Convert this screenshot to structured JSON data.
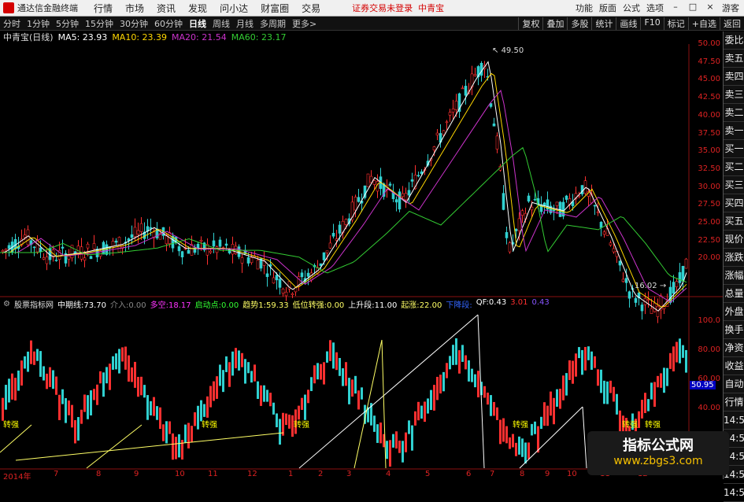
{
  "app": {
    "title": "通达信金融终端",
    "login_notice": "证券交易未登录",
    "stock_name_red": "中青宝"
  },
  "menu": [
    "行情",
    "市场",
    "资讯",
    "发现",
    "问小达",
    "财富圈",
    "交易"
  ],
  "right_menu": [
    "功能",
    "版面",
    "公式",
    "选项"
  ],
  "window_buttons": [
    "游客"
  ],
  "periods": [
    "分时",
    "1分钟",
    "5分钟",
    "15分钟",
    "30分钟",
    "60分钟",
    "日线",
    "周线",
    "月线",
    "多周期",
    "更多>"
  ],
  "active_period": "日线",
  "right_tools": [
    "复权",
    "叠加",
    "多股",
    "统计",
    "画线",
    "F10",
    "标记",
    "+自选",
    "返回"
  ],
  "stock": {
    "title": "中青宝(日线)",
    "ma5": "MA5: 23.93",
    "ma10": "MA10: 23.39",
    "ma20": "MA20: 21.54",
    "ma60": "MA60: 23.17"
  },
  "colors": {
    "ma5": "#ffffff",
    "ma10": "#ffd700",
    "ma20": "#cc33cc",
    "ma60": "#33cc33",
    "up": "#ff3030",
    "down": "#30d0d0",
    "axis": "#d22"
  },
  "price_axis": [
    "50.00",
    "47.50",
    "45.00",
    "42.50",
    "40.00",
    "37.50",
    "35.00",
    "32.50",
    "30.00",
    "27.50",
    "25.00",
    "22.50",
    "20.00"
  ],
  "annotations": {
    "high": "49.50",
    "low": "16.02"
  },
  "indicator": {
    "name": "股票指标网",
    "items": [
      {
        "label": "中期线:",
        "value": "73.70",
        "color": "#ffffff"
      },
      {
        "label": "介入:",
        "value": "0.00",
        "color": "#888888"
      },
      {
        "label": "多空:",
        "value": "18.17",
        "color": "#ff33ff"
      },
      {
        "label": "启动点:",
        "value": "0.00",
        "color": "#33ff33"
      },
      {
        "label": "趋势1:",
        "value": "59.33",
        "color": "#ffff66"
      },
      {
        "label": "低位转强:",
        "value": "0.00",
        "color": "#ffff66"
      },
      {
        "label": "上升段:",
        "value": "11.00",
        "color": "#ffffff"
      },
      {
        "label": "起涨:",
        "value": "22.00",
        "color": "#ffff66"
      },
      {
        "label": "下降段:",
        "value": "",
        "color": "#3366ff"
      },
      {
        "label": "QF:",
        "value": "0.43",
        "color": "#ffffff"
      },
      {
        "label": "",
        "value": "3.01",
        "color": "#ff3030"
      },
      {
        "label": "",
        "value": "0.43",
        "color": "#8855ff"
      }
    ],
    "axis": [
      "100.0",
      "80.00",
      "60.00",
      "40.00",
      "20.00"
    ],
    "current_value": "50.95",
    "marker_label": "转强"
  },
  "x_axis": [
    "2014年",
    "7",
    "8",
    "9",
    "10",
    "11",
    "12",
    "1",
    "2",
    "3",
    "4",
    "5",
    "6",
    "7",
    "8",
    "9",
    "10",
    "11",
    "12"
  ],
  "sidebar": [
    "委比",
    "卖五",
    "卖四",
    "卖三",
    "卖二",
    "卖一",
    "买一",
    "买二",
    "买三",
    "买四",
    "买五",
    "现价",
    "涨跌",
    "涨幅",
    "总量",
    "外盘",
    "换手",
    "净资",
    "收益",
    "自动",
    "行情",
    "14:5",
    "14:5",
    "14:5",
    "14:5",
    "14:5"
  ],
  "watermark": {
    "title": "指标公式网",
    "url": "www.zbgs3.com"
  }
}
